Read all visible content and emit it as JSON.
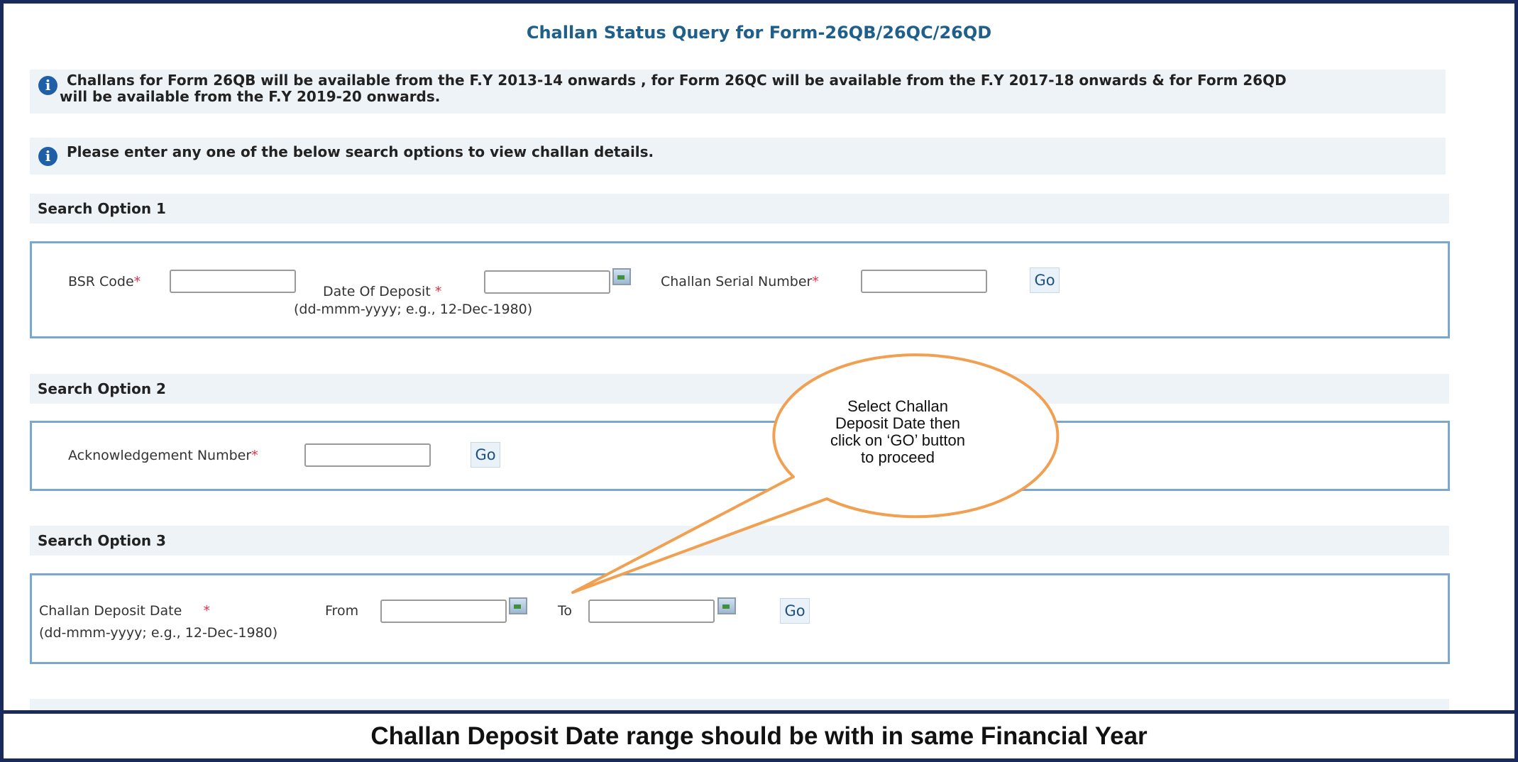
{
  "page": {
    "title": "Challan Status Query for Form-26QB/26QC/26QD"
  },
  "info": [
    {
      "line1": "Challans for Form 26QB will be available from the F.Y 2013-14 onwards , for Form 26QC will be available from the F.Y 2017-18 onwards & for Form 26QD",
      "line2": "will be available from the F.Y 2019-20 onwards."
    },
    {
      "line1": "Please enter any one of the below search options to view challan details."
    }
  ],
  "option1": {
    "heading": "Search Option 1",
    "bsr_label": "BSR Code",
    "date_label": "Date Of Deposit",
    "date_hint": "(dd-mmm-yyyy; e.g., 12-Dec-1980)",
    "serial_label": "Challan Serial Number",
    "required_mark": "*",
    "go_label": "Go"
  },
  "option2": {
    "heading": "Search Option 2",
    "ack_label": "Acknowledgement Number",
    "required_mark": "*",
    "go_label": "Go"
  },
  "option3": {
    "heading": "Search Option 3",
    "date_label": "Challan Deposit Date",
    "required_mark": "*",
    "from_label": "From",
    "to_label": "To",
    "date_hint": "(dd-mmm-yyyy; e.g., 12-Dec-1980)",
    "go_label": "Go"
  },
  "callout": {
    "line1": "Select Challan",
    "line2": "Deposit Date then",
    "line3": "click on ‘GO’ button",
    "line4": "to proceed",
    "color": "#f0a050"
  },
  "banner": {
    "text": "Challan Deposit Date range should be with in same Financial Year"
  },
  "colors": {
    "frame": "#1a2a5a",
    "title": "#1f5f8b",
    "panel_border": "#7aa7cb",
    "required": "#e0304a"
  }
}
